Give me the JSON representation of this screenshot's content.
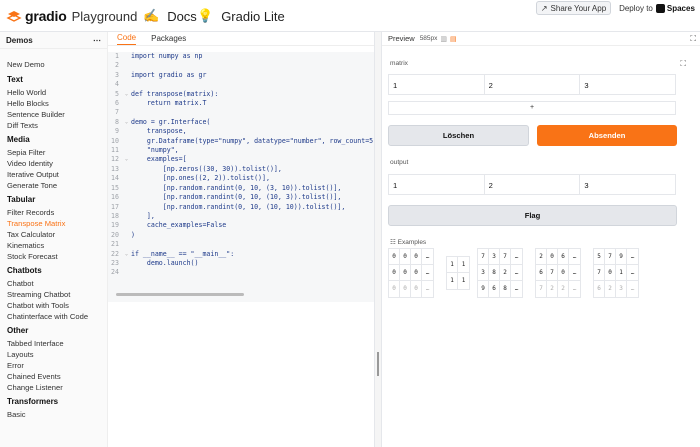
{
  "header": {
    "logo": "gradio",
    "subtitle": "Playground",
    "docs_icon": "docs-icon",
    "docs_label": "Docs",
    "lite_icon": "bulb-icon",
    "lite_label": "Gradio Lite",
    "share_label": "Share Your App",
    "deploy_label": "Deploy to",
    "spaces_label": "Spaces"
  },
  "sidebar": {
    "title": "Demos",
    "collapse": "⋯",
    "new_demo": "New Demo",
    "categories": [
      {
        "name": "Text",
        "items": [
          "Hello World",
          "Hello Blocks",
          "Sentence Builder",
          "Diff Texts"
        ]
      },
      {
        "name": "Media",
        "items": [
          "Sepia Filter",
          "Video Identity",
          "Iterative Output",
          "Generate Tone"
        ]
      },
      {
        "name": "Tabular",
        "items": [
          "Filter Records",
          "Transpose Matrix",
          "Tax Calculator",
          "Kinematics",
          "Stock Forecast"
        ]
      },
      {
        "name": "Chatbots",
        "items": [
          "Chatbot",
          "Streaming Chatbot",
          "Chatbot with Tools",
          "Chatinterface with Code"
        ]
      },
      {
        "name": "Other",
        "items": [
          "Tabbed Interface",
          "Layouts",
          "Error",
          "Chained Events",
          "Change Listener"
        ]
      },
      {
        "name": "Transformers",
        "items": [
          "Basic"
        ]
      }
    ],
    "active_item": "Transpose Matrix"
  },
  "editor": {
    "tabs": [
      "Code",
      "Packages"
    ],
    "active_tab": "Code",
    "lines": [
      "import numpy as np",
      "",
      "import gradio as gr",
      "",
      "def transpose(matrix):",
      "    return matrix.T",
      "",
      "demo = gr.Interface(",
      "    transpose,",
      "    gr.Dataframe(type=\"numpy\", datatype=\"number\", row_count=5",
      "    \"numpy\",",
      "    examples=[",
      "        [np.zeros((30, 30)).tolist()],",
      "        [np.ones((2, 2)).tolist()],",
      "        [np.random.randint(0, 10, (3, 10)).tolist()],",
      "        [np.random.randint(0, 10, (10, 3)).tolist()],",
      "        [np.random.randint(0, 10, (10, 10)).tolist()],",
      "    ],",
      "    cache_examples=False",
      ")",
      "",
      "if __name__ == \"__main__\":",
      "    demo.launch()",
      ""
    ],
    "fold_lines": [
      5,
      8,
      12,
      22
    ]
  },
  "preview": {
    "title": "Preview",
    "width_label": "585px",
    "input_label": "matrix",
    "input_headers": [
      "1",
      "2",
      "3"
    ],
    "add_row": "+",
    "clear_label": "Löschen",
    "submit_label": "Absenden",
    "output_label": "output",
    "output_headers": [
      "1",
      "2",
      "3"
    ],
    "flag_label": "Flag",
    "examples_label": "Examples",
    "examples": [
      {
        "rows": [
          [
            "0",
            "0",
            "0",
            "…"
          ],
          [
            "0",
            "0",
            "0",
            "…"
          ],
          [
            "0",
            "0",
            "0",
            "…"
          ]
        ],
        "faded_last": true
      },
      {
        "rows": [
          [
            "1",
            "1"
          ],
          [
            "1",
            "1"
          ]
        ],
        "faded_last": false
      },
      {
        "rows": [
          [
            "7",
            "3",
            "7",
            "…"
          ],
          [
            "3",
            "8",
            "2",
            "…"
          ],
          [
            "9",
            "6",
            "8",
            "…"
          ]
        ],
        "faded_last": false
      },
      {
        "rows": [
          [
            "2",
            "0",
            "6",
            "…"
          ],
          [
            "6",
            "7",
            "0",
            "…"
          ],
          [
            "7",
            "2",
            "2",
            "…"
          ]
        ],
        "faded_last": true
      },
      {
        "rows": [
          [
            "5",
            "7",
            "9",
            "…"
          ],
          [
            "7",
            "0",
            "1",
            "…"
          ],
          [
            "6",
            "2",
            "3",
            "…"
          ]
        ],
        "faded_last": true
      }
    ]
  },
  "colors": {
    "accent": "#f97316"
  }
}
